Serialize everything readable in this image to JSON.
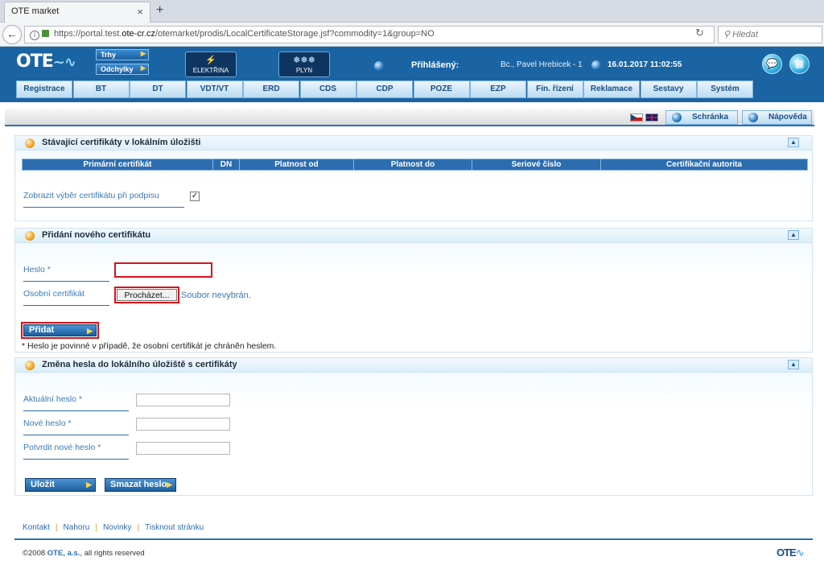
{
  "browser": {
    "tab_title": "OTE market",
    "tab_close": "×",
    "new_tab": "+",
    "url_prefix": "https://portal.test.",
    "url_host": "ote-cr.cz",
    "url_path": "/otemarket/prodis/LocalCertificateStorage.jsf?commodity=1&group=NO",
    "search_placeholder": "Hledat"
  },
  "header": {
    "logo": "OTE",
    "market_buttons": [
      "Trhy",
      "Odchylky"
    ],
    "commodities": [
      {
        "label": "ELEKTŘINA",
        "icon": "plug-icon"
      },
      {
        "label": "PLYN",
        "icon": "flame-icon"
      }
    ],
    "logged_in_label": "Přihlášený:",
    "user_name": "Bc., Pavel Hrebicek - 1",
    "datetime": "16.01.2017 11:02:55",
    "menu": [
      "Registrace",
      "BT",
      "DT",
      "VDT/VT",
      "ERD",
      "CDS",
      "CDP",
      "POZE",
      "EZP",
      "Fin. řízení",
      "Reklamace",
      "Sestavy",
      "Systém"
    ]
  },
  "toolbar": {
    "inbox_label": "Schránka",
    "help_label": "Nápověda"
  },
  "panel_existing": {
    "title": "Stávající certifikáty v lokálním úložišti",
    "columns": [
      "Primární certifikát",
      "DN",
      "Platnost od",
      "Platnost do",
      "Seriové číslo",
      "Certifikační autorita"
    ],
    "show_selection_label": "Zobrazit výběr certifikátu při podpisu",
    "show_selection_checked": true
  },
  "panel_add": {
    "title": "Přidání nového certifikátu",
    "password_label": "Heslo *",
    "personal_cert_label": "Osobní certifikát",
    "browse_label": "Procházet...",
    "no_file_text": "Soubor nevybrán.",
    "add_button": "Přidat",
    "note": "* Heslo je povinné v případě, že osobní certifikát je chráněn heslem."
  },
  "panel_change": {
    "title": "Změna hesla do lokálního úložiště s certifikáty",
    "current_label": "Aktuální heslo *",
    "new_label": "Nové heslo *",
    "confirm_label": "Potvrdit nové heslo *",
    "save_button": "Uložit",
    "delete_button": "Smazat heslo"
  },
  "footer": {
    "links": [
      "Kontakt",
      "Nahoru",
      "Novinky",
      "Tisknout stránku"
    ],
    "copyright_prefix": "©2008 ",
    "company": "OTE, a.s.",
    "rights": ", all rights reserved",
    "logo": "OTE"
  },
  "colors": {
    "header_blue": "#1a64a3",
    "table_header": "#2c6db0",
    "highlight_red": "#d9101a",
    "bullet_orange": "#f5a01d"
  }
}
